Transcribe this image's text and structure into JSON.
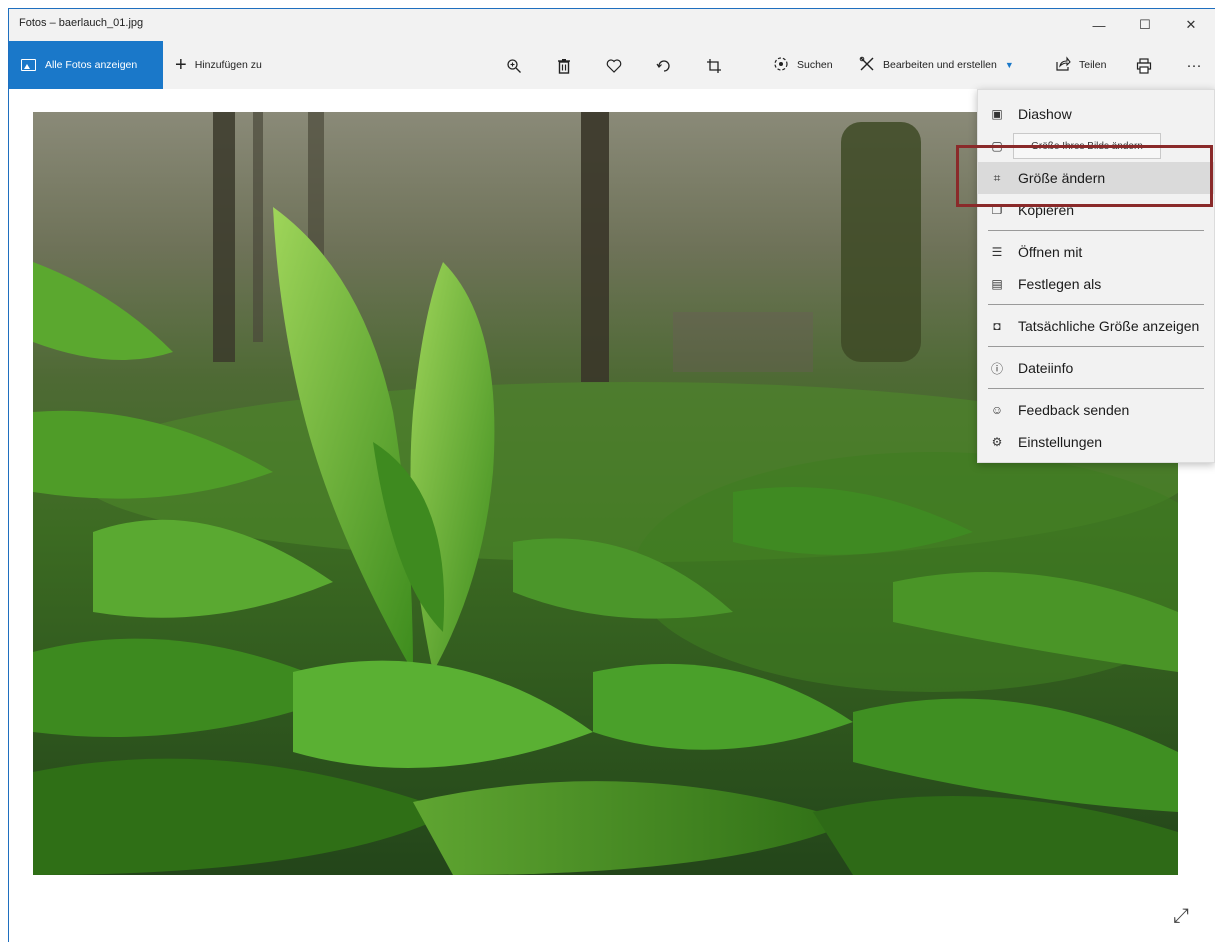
{
  "window": {
    "title": "Fotos – baerlauch_01.jpg",
    "minimize_glyph": "—",
    "maximize_glyph": "☐",
    "close_glyph": "✕"
  },
  "toolbar": {
    "all_photos_label": "Alle Fotos anzeigen",
    "add_to_label": "Hinzufügen zu",
    "search_label": "Suchen",
    "edit_create_label": "Bearbeiten und erstellen",
    "share_label": "Teilen",
    "more_glyph": "···",
    "icons": [
      "zoom-icon",
      "delete-icon",
      "favorite-icon",
      "rotate-icon",
      "crop-icon",
      "search-icon",
      "edit-icon",
      "share-icon",
      "print-icon",
      "more-icon"
    ],
    "accent_color": "#1a78c9"
  },
  "menu": {
    "items": [
      {
        "label": "Diashow",
        "icon": "slideshow-icon"
      },
      {
        "label": "Größe Ihres Bilds ändern",
        "icon": "resize-icon"
      },
      {
        "label": "Größe ändern",
        "icon": "resize-icon"
      },
      {
        "label": "Kopieren",
        "icon": "copy-icon"
      },
      {
        "label": "Öffnen mit",
        "icon": "open-with-icon"
      },
      {
        "label": "Festlegen als",
        "icon": "set-as-icon"
      },
      {
        "label": "Tatsächliche Größe anzeigen",
        "icon": "actual-size-icon"
      },
      {
        "label": "Dateiinfo",
        "icon": "info-icon"
      },
      {
        "label": "Feedback senden",
        "icon": "feedback-icon"
      },
      {
        "label": "Einstellungen",
        "icon": "settings-icon"
      }
    ],
    "tooltip": "Größe Ihres Bilds ändern",
    "highlight_color": "#8a2a2a"
  }
}
